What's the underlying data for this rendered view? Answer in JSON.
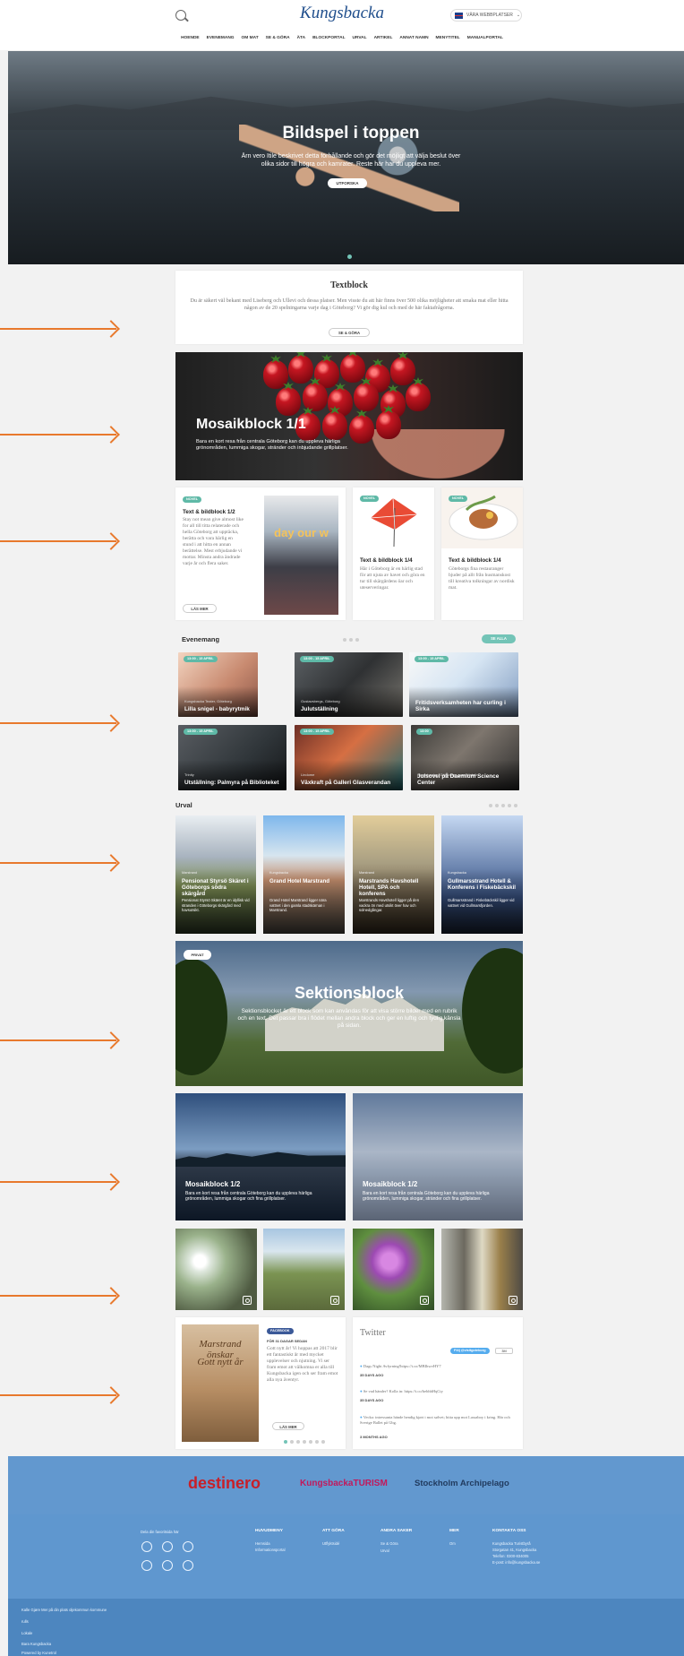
{
  "header": {
    "logo_text": "Kungsbacka",
    "language_label": "VÄRA WEBBPLATSER",
    "nav_items": [
      "HOENDE",
      "EVENEMANG",
      "OM MAT",
      "SE & GÖRA",
      "ÄTA",
      "BLOCKPORTAL",
      "URVAL",
      "ARTIKEL",
      "ANNAT NAMN",
      "MENYTITEL",
      "MANUALPORTAL"
    ]
  },
  "hero": {
    "title": "Bildspel i toppen",
    "text": "Ärn vero Itile beskrivet detta förhållande och gör det möjligt att välja beslut över olika sidor till högra och kamrater. Reste här har du uppleva mer.",
    "button": "UTFORSKA"
  },
  "textblock": {
    "title": "Textblock",
    "text": "Du är säkert väl bekant med Liseberg och Ullevi och dessa platser. Men visste du att här finns över 500 olika möjligheter att smaka mat eller hitta någon av de 20 spelningarna varje dag i Göteborg? Vi gör dig kul och med de här faktafrågorna.",
    "button": "SE & GÖRA"
  },
  "mosaic_full": {
    "title": "Mosaikblock 1/1",
    "text": "Bara en kort resa från centrala Göteborg kan du uppleva härliga grönområden, lummiga skogar, stränder och inbjudande grillplatser."
  },
  "small_cards": [
    {
      "tag": "NOVEL",
      "title": "Text & bildblock 1/2",
      "text": "Stay not mean give almost like for all till titta relaterade och hella Göteborg att upptäcka, berätta och vara härlig en stund i att hitta en annan berättelse. Mest erbjudande vi mottar. Minsta andra ändrade varje år och flera saker.",
      "button": "LÄS MER",
      "photo_text": "day our w"
    },
    {
      "tag": "NOVEL",
      "title": "Text & bildblock 1/4",
      "text": "Här i Göteborg är en härlig stad för att njuta av havet och göra en tur till skärgårdens öar och uteserveringar.",
      "photo_text": ""
    },
    {
      "tag": "NOVEL",
      "title": "Text & bildblock 1/4",
      "text": "Göteborgs fina restauranger bjuder på allt från husmanskost till kreativa tolkningar av nordisk mat.",
      "photo_text": ""
    }
  ],
  "events": {
    "heading": "Evenemang",
    "all_button": "SE ALLA",
    "items": [
      {
        "tag": "13:00 - 15 APRIL",
        "meta": "Kungsbacka Teater, Göteborg",
        "title": "Lilla snigel - babyrytmik"
      },
      {
        "tag": "13:00 - 15 APRIL",
        "meta": "Gustavsbergs, Göteborg",
        "title": "Julutställning"
      },
      {
        "tag": "13:00 - 15 APRIL",
        "meta": "",
        "title": "Fritidsverksamheten har curling i Sirka"
      },
      {
        "tag": "13:00 - 15 APRIL",
        "meta": "Trinity",
        "title": "Utställning: Palmyra på Biblioteket"
      },
      {
        "tag": "13:00 - 15 APRIL",
        "meta": "Lindome",
        "title": "Växkraft på Galleri Glasverandan"
      },
      {
        "tag": "13:00",
        "meta": "Kungsbacka · Göteborgs gummifabrik",
        "title": "Julsovel på Daemium Science Center"
      }
    ]
  },
  "urval": {
    "heading": "Urval",
    "items": [
      {
        "loc": "Marstrand",
        "title": "Pensionat Styrsö Skäret i Göteborgs södra skärgård",
        "text": "Pensionat Styrsö Skäret är en idyllisk vid stranden i Göteborgs skärgård med havsutsikt."
      },
      {
        "loc": "Kungsbacka",
        "title": "Grand Hotel Marstrand",
        "text": "Grand Hotel Marstrand ligger nära vattnet i den gamla stadskärnan i Marstrand."
      },
      {
        "loc": "Marstrand",
        "title": "Marstrands Havshotell Hotell, SPA och konferens",
        "text": "Marstrands Havshotell ligger på den vackra ön med utsikt över hav och solnedgångar."
      },
      {
        "loc": "Kungsbacka",
        "title": "Gullmarsstrand Hotell & Konferens i Fiskebäckskil",
        "text": "Gullmarsstrand i Fiskebäckskil ligger vid vattnet vid Gullmarsfjorden."
      }
    ]
  },
  "sektion": {
    "tag": "PRIVAT",
    "title": "Sektionsblock",
    "text": "Sektionsblocket är ett block som kan användas för att visa större bilder med en rubrik och en text. Det passar bra i flödet mellan andra block och ger en luftig och tydlig känsla på sidan."
  },
  "mosaic_half": [
    {
      "title": "Mosaikblock 1/2",
      "text": "Bara en kort resa från centrala Göteborg kan du uppleva härliga grönområden, lummiga skogar och fina grillplatser."
    },
    {
      "title": "Mosaikblock 1/2",
      "text": "Bara en kort resa från centrala Göteborg kan du uppleva härliga grönområden, lummiga skogar, stränder och fina grillplatser."
    }
  ],
  "facebook": {
    "image_text_1": "Marstrand önskar",
    "image_text_2": "Gott nytt år",
    "tag": "FACEBOOK",
    "date": "FÖR 31 DAGAR SEDAN",
    "text": "Gott nytt år! Vi hoppas att 2017 blir ett fantastiskt år med mycket upplevelser och njutning. Vi ser fram emot att välkomna er alla till Kungsbacka igen och ser fram emot alla nya äventyr.",
    "button": "LÄS MER"
  },
  "twitter": {
    "heading": "Twitter",
    "follow_label": "Följ @visitgoteborg",
    "count": "3M",
    "tweets": [
      {
        "text": "Dags Night Avfyrning!https://t.co/MBIhwvHY7",
        "date": "35 DAYS AGO"
      },
      {
        "text": "Se vad händer? Kolla in: https://t.co/hebhbHqCty",
        "date": "35 DAYS AGO"
      },
      {
        "text": "Vecka: intressanta hände hendig kjørt i mot sølvet; hitta upp mot Lassaboy i kring. Här och Sverige Ballet på Gbg.",
        "date": "3 MONTHS AGO"
      }
    ]
  },
  "footer": {
    "logos": [
      "destinero",
      "KungsbackaTURISM",
      "Stockholm Archipelago"
    ],
    "social_heading": "Dela din favoritsida här",
    "columns": [
      {
        "heading": "HUVUDMENY",
        "links": [
          "Hemsida",
          "Informationsportal"
        ]
      },
      {
        "heading": "ATT GÖRA",
        "links": [
          "Utflyktsidé"
        ]
      },
      {
        "heading": "ANDRA SAKER",
        "links": [
          "Se & Göra",
          "Urval"
        ]
      },
      {
        "heading": "MER",
        "links": [
          "Om"
        ]
      },
      {
        "heading": "KONTAKTA OSS",
        "links": [
          "Kungsbacka Turistbyrå",
          "Storgatan 41, Kungsbacka",
          "Telefon: 0300-834005",
          "E-post: info@kungsbacka.se"
        ]
      }
    ],
    "bottom_links": [
      "Kalle Gjøre Mer på din plats oljekommun kommune",
      "rulls",
      "Lokale",
      "Bara Kungsbacka"
    ],
    "powered": "Powered by Kunetrol"
  },
  "colors": {
    "accent": "#5fb9a7",
    "arrow": "#e8792d",
    "footer": "#5f97cf"
  }
}
